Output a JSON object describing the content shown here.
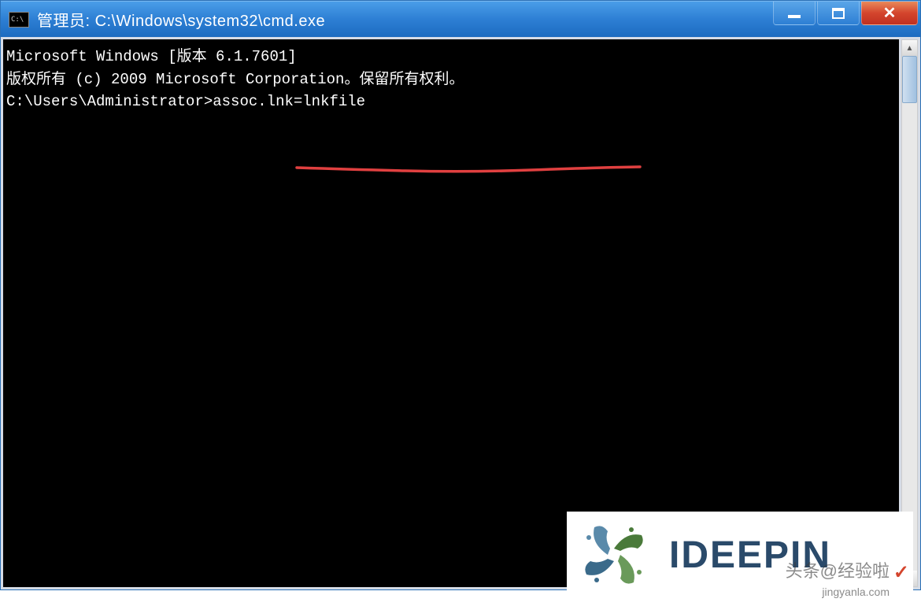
{
  "window": {
    "icon_text": "C:\\",
    "title": "管理员: C:\\Windows\\system32\\cmd.exe"
  },
  "terminal": {
    "line1": "Microsoft Windows [版本 6.1.7601]",
    "line2": "版权所有 (c) 2009 Microsoft Corporation。保留所有权利。",
    "line3": "",
    "prompt": "C:\\Users\\Administrator>",
    "command": "assoc.lnk=lnkfile"
  },
  "logo": {
    "text": "IDEEPIN"
  },
  "watermark": {
    "text": "头条@经验啦",
    "url": "jingyanla.com",
    "check": "✓"
  }
}
